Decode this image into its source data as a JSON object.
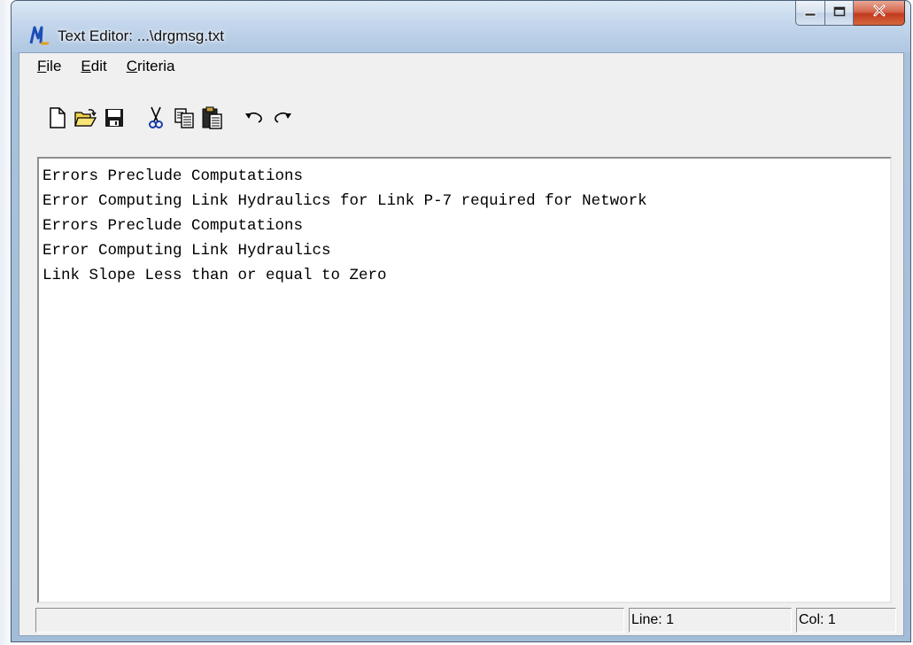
{
  "window": {
    "title": "Text Editor: ...\\drgmsg.txt",
    "app_icon": "app-logo-icon"
  },
  "caption_buttons": [
    "minimize-icon",
    "maximize-icon",
    "close-icon"
  ],
  "menu": [
    {
      "label": "File",
      "accel": "F",
      "rest": "ile"
    },
    {
      "label": "Edit",
      "accel": "E",
      "rest": "dit"
    },
    {
      "label": "Criteria",
      "accel": "C",
      "rest": "riteria"
    }
  ],
  "toolbar": [
    "new-file-icon",
    "open-folder-icon",
    "save-icon",
    "cut-icon",
    "copy-icon",
    "paste-icon",
    "undo-icon",
    "redo-icon"
  ],
  "editor": {
    "lines": [
      "Errors Preclude Computations",
      "Error Computing Link Hydraulics for Link P-7 required for Network",
      "Errors Preclude Computations",
      "Error Computing Link Hydraulics",
      "Link Slope Less than or equal to Zero"
    ]
  },
  "status": {
    "main": "",
    "line": "Line: 1",
    "col": "Col: 1"
  },
  "colors": {
    "frame": "#a9c2dc",
    "close_button": "#c13a1f",
    "icon_blue": "#1a3fa8"
  }
}
